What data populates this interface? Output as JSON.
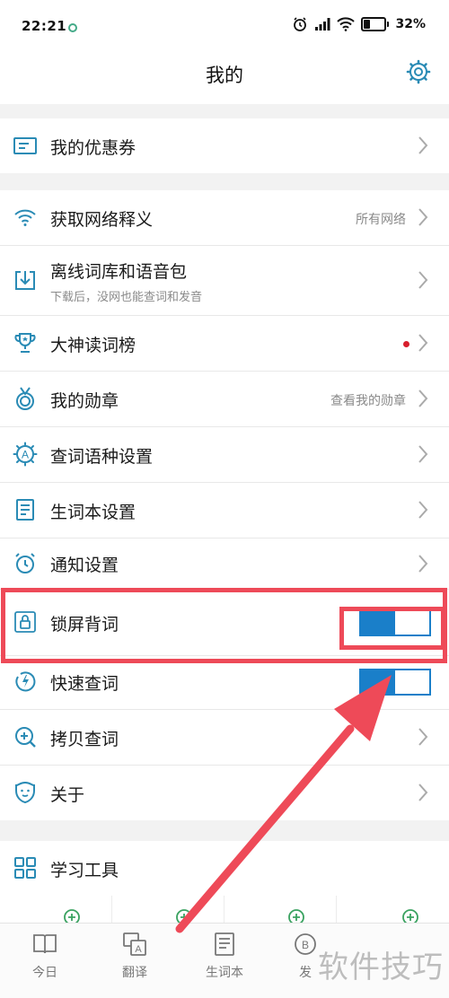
{
  "status_bar": {
    "time": "22:21",
    "battery_percent": "32%",
    "battery_level": 0.32
  },
  "header": {
    "title": "我的",
    "settings_icon": "gear-icon"
  },
  "coupon": {
    "label": "我的优惠券",
    "icon": "coupon-icon"
  },
  "menu": [
    {
      "label": "获取网络释义",
      "hint": "所有网络",
      "icon": "wifi-icon"
    },
    {
      "label": "离线词库和语音包",
      "subtitle": "下载后，没网也能查词和发音",
      "icon": "download-icon"
    },
    {
      "label": "大神读词榜",
      "badge_color": "#d81e2c",
      "icon": "trophy-icon"
    },
    {
      "label": "我的勋章",
      "hint": "查看我的勋章",
      "icon": "medal-icon"
    },
    {
      "label": "查词语种设置",
      "icon": "language-icon"
    },
    {
      "label": "生词本设置",
      "icon": "notebook-icon"
    },
    {
      "label": "通知设置",
      "icon": "alarm-icon"
    },
    {
      "label": "锁屏背词",
      "toggle": true,
      "icon": "lock-icon"
    },
    {
      "label": "快速查词",
      "toggle": true,
      "icon": "lightning-icon"
    },
    {
      "label": "拷贝查词",
      "icon": "zoom-in-icon"
    },
    {
      "label": "关于",
      "icon": "about-icon"
    }
  ],
  "tools": {
    "label": "学习工具",
    "icon": "grid-icon"
  },
  "tabs": [
    {
      "label": "今日",
      "icon": "book-icon"
    },
    {
      "label": "翻译",
      "icon": "translate-icon"
    },
    {
      "label": "生词本",
      "icon": "notebook-tab-icon"
    },
    {
      "label": "发",
      "icon": "discover-icon"
    }
  ],
  "watermark": "软件技巧",
  "colors": {
    "accent": "#1a7fc9",
    "icon": "#2a8bb5",
    "annotation": "#ee4a58",
    "badge": "#d81e2c"
  }
}
